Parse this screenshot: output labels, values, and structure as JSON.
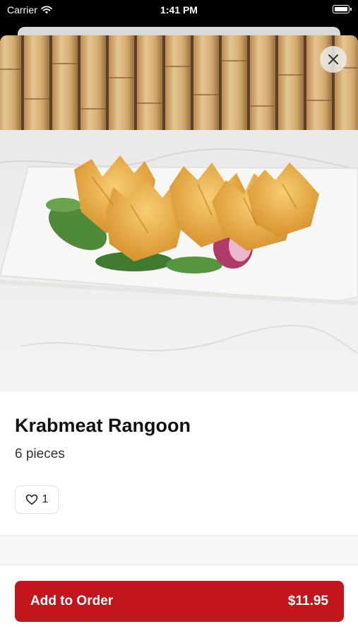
{
  "status_bar": {
    "carrier": "Carrier",
    "time": "1:41 PM"
  },
  "item": {
    "name": "Krabmeat Rangoon",
    "description": "6 pieces",
    "like_count": "1"
  },
  "order_button": {
    "label": "Add to Order",
    "price": "$11.95"
  },
  "colors": {
    "accent": "#c3161c"
  },
  "icons": {
    "close": "close-icon",
    "like": "heart-icon",
    "wifi": "wifi-icon",
    "battery": "battery-icon"
  }
}
